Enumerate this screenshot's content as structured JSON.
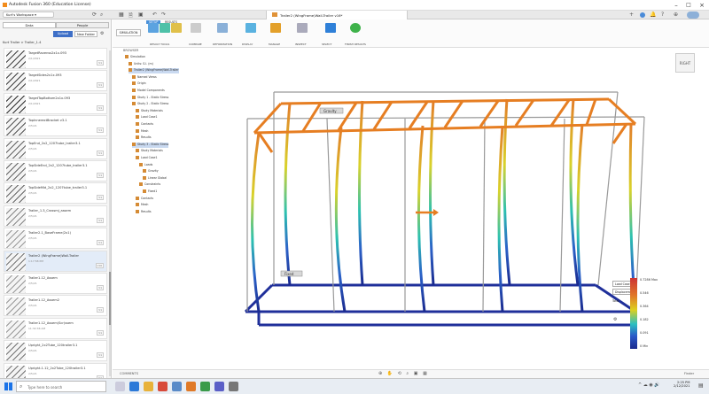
{
  "app_title": "Autodesk Fusion 360 (Education License)",
  "doc_title": "Trailer2 (WingFrame)Wall-Trailer v16*",
  "panel": {
    "tab_data": "Data",
    "tab_people": "People",
    "upload": "Upload",
    "new_folder": "New Folder",
    "breadcrumb": "Kurt Trailer > Trailer_1.4",
    "items": [
      {
        "name": "TargetRavenss2x1x.093",
        "date": "2/1/2021",
        "ver": "V1"
      },
      {
        "name": "TargetSides2x1x.093",
        "date": "2/1/2021",
        "ver": "V1"
      },
      {
        "name": "TargetTopBottom2x1x.093",
        "date": "2/1/2021",
        "ver": "V1"
      },
      {
        "name": "TopInnerextBracket v3.1",
        "date": "2/5/21",
        "ver": "V1"
      },
      {
        "name": "TopEnd_2x2_1207tube_trailer3.1",
        "date": "2/5/21",
        "ver": "V1"
      },
      {
        "name": "TopSideEnd_2x2_1207tube_trailer3.1",
        "date": "2/5/21",
        "ver": "V1"
      },
      {
        "name": "TopSideMid_2x2_1207tube_trailer3.1",
        "date": "2/5/21",
        "ver": "V1"
      },
      {
        "name": "Trailer_1.3_Crossmj_assem",
        "date": "2/5/21",
        "ver": "V1"
      },
      {
        "name": "Trailer2.1_BaseFrame(2x1)",
        "date": "2/5/21",
        "ver": "V1"
      },
      {
        "name": "Trailer2 (WingFrame)Wall-Trailer",
        "date": "1:17:58 PM",
        "ver": "V16"
      },
      {
        "name": "Trailer1.12_Assem",
        "date": "2/5/21",
        "ver": "V1"
      },
      {
        "name": "Trailer1.12_Assem2",
        "date": "2/5/21",
        "ver": "V1"
      },
      {
        "name": "Trailer1.12_Assem(Scr)ssem",
        "date": "11:32:36 AM",
        "ver": "V1"
      },
      {
        "name": "Upright_2x2Tube_120trailer3.1",
        "date": "2/5/21",
        "ver": "V1"
      },
      {
        "name": "Upright-1.12_2x2Tube_120trailer3.1",
        "date": "2/5/21",
        "ver": "V1"
      }
    ]
  },
  "toolbar": {
    "mode": "SIMULATION",
    "setup_tab": "SETUP",
    "results_tab": "RESULTS",
    "groups": [
      "RESULT TOOLS",
      "COMPARE",
      "DEFORMATION",
      "DISPLAY",
      "MANAGE",
      "INSPECT",
      "SELECT",
      "FINISH RESULTS"
    ]
  },
  "browser": {
    "title": "BROWSER",
    "rows": [
      "Simulation",
      "Units: S.I. (m)",
      "Trailer2 (WingFrame)Wall-Trailer",
      "Named Views",
      "Origin",
      "Model Components",
      "Study 1 - Static Stress",
      "Study 2 - Static Stress",
      "Study Materials",
      "Load Case1",
      "Contacts",
      "Mesh",
      "Results",
      "Study 3 - Static Stress",
      "Study Materials",
      "Load Case1",
      "Loads",
      "Gravity",
      "Linear Global",
      "Constraints",
      "Fixed1",
      "Contacts",
      "Mesh",
      "Results"
    ]
  },
  "legend": {
    "dropdown1": "Load Case1",
    "dropdown2": "Displacement",
    "unit": "Total",
    "scale": [
      "0.7286 Max",
      "0.546",
      "0.364",
      "0.182",
      "0.091",
      "0 Min"
    ]
  },
  "labels": {
    "load_tag": "Gravity",
    "disp_tag": "Fixed"
  },
  "nav_cube": "RIGHT",
  "bottom": {
    "comments": "COMMENTS",
    "finder": "Finder"
  },
  "taskbar": {
    "search": "Type here to search",
    "time": "2:25 PM",
    "date": "2/12/2021"
  }
}
